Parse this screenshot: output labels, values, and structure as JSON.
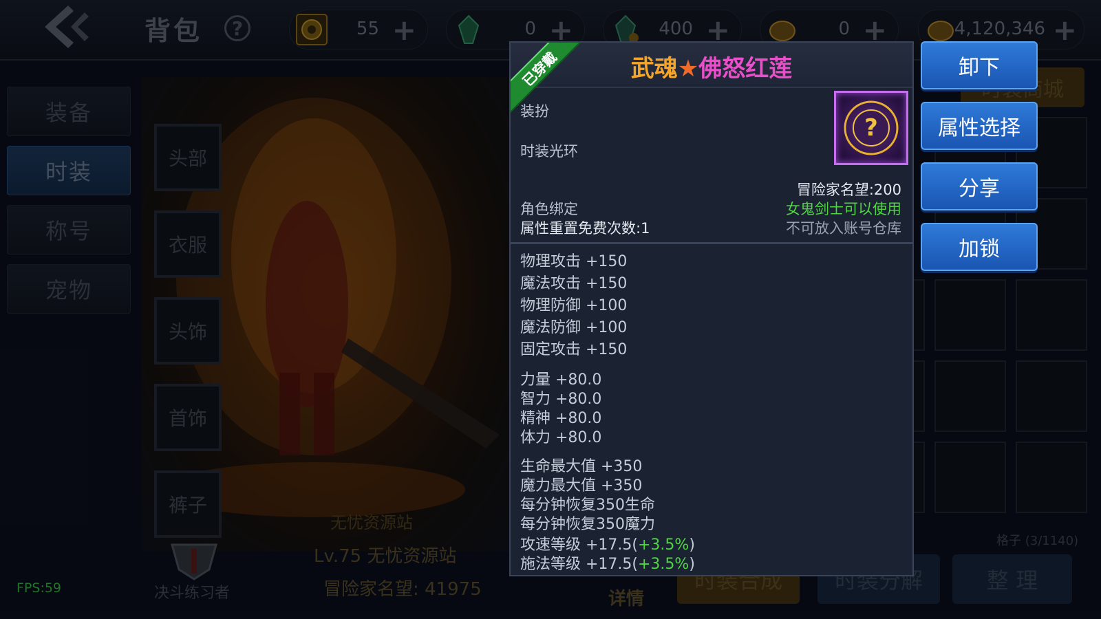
{
  "header": {
    "title": "背包",
    "currencies": [
      {
        "icon": "emblem-coin-icon",
        "value": "55"
      },
      {
        "icon": "green-crystal-icon",
        "value": "0"
      },
      {
        "icon": "green-crystal-alt-icon",
        "value": "400"
      },
      {
        "icon": "gold-coin-icon",
        "value": "0"
      },
      {
        "icon": "gold-coin-stack-icon",
        "value": "4,120,346"
      }
    ]
  },
  "sidebar": {
    "tabs": [
      {
        "label": "装备"
      },
      {
        "label": "时装"
      },
      {
        "label": "称号"
      },
      {
        "label": "宠物"
      }
    ]
  },
  "slots": [
    "头部",
    "衣服",
    "头饰",
    "首饰",
    "裤子"
  ],
  "character": {
    "name": "无忧资源站",
    "level": "Lv.75 无忧资源站",
    "fame": "冒险家名望: 41975",
    "duel_title": "决斗练习者",
    "detail_link": "详情"
  },
  "right": {
    "shop_label": "时装商城",
    "grid_count": "格子 (3/1140)",
    "bottom_buttons": [
      "时装合成",
      "时装分解",
      "整 理"
    ]
  },
  "fps": "FPS:59",
  "tooltip": {
    "worn": "已穿戴",
    "title_part1": "武魂",
    "title_star": "★",
    "title_part2": "佛怒红莲",
    "category": "装扮",
    "subcategory": "时装光环",
    "fame": "冒险家名望:200",
    "bind": "角色绑定",
    "usable_by": "女鬼剑士可以使用",
    "reset_count": "属性重置免费次数:1",
    "storage_note": "不可放入账号仓库",
    "stats_group1": [
      "物理攻击 +150",
      "魔法攻击 +150",
      "物理防御 +100",
      "魔法防御 +100",
      "固定攻击 +150"
    ],
    "stats_group2": [
      "力量 +80.0",
      "智力 +80.0",
      "精神 +80.0",
      "体力 +80.0"
    ],
    "stats_group3": [
      "生命最大值 +350",
      "魔力最大值 +350",
      "每分钟恢复350生命",
      "每分钟恢复350魔力"
    ],
    "speed_stats": [
      {
        "label": "攻速等级 +17.5(",
        "bonus": "+3.5%",
        "close": ")"
      },
      {
        "label": "施法等级 +17.5(",
        "bonus": "+3.5%",
        "close": ")"
      }
    ]
  },
  "actions": [
    "卸下",
    "属性选择",
    "分享",
    "加锁"
  ],
  "colors": {
    "title_orange": "#f4a52a",
    "title_pink": "#e84fc8",
    "usable_green": "#4fd642",
    "button_blue": "#2f7ad8"
  }
}
